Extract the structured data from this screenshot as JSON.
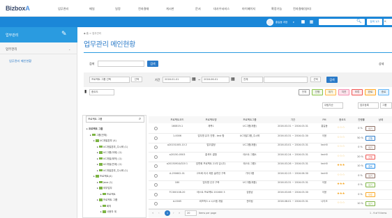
{
  "brand": {
    "name": "BizboxA",
    "suffix": "A"
  },
  "top_menu": [
    "업무관리",
    "메일",
    "일정",
    "전자결재",
    "게시판",
    "문서",
    "대사우서비스",
    "마이페이지",
    "확장기능",
    "전자결재(영리)"
  ],
  "header": {
    "user_name": "홍길동 과장",
    "search_btn": "검색 1/3"
  },
  "sidebar": {
    "title": "업무관리",
    "section": "업무관리",
    "item": "업무관리 메인현황"
  },
  "breadcrumb": "◆ 홈 > 업무관리",
  "page_title": "업무관리 메인현황",
  "filter1": {
    "label": "검색",
    "search_btn": "검색",
    "right_label": "상세"
  },
  "filter2": {
    "select1": "프로젝트 그룹 선택",
    "btn_select": "선택",
    "period_label": "기간",
    "date_from": "2016-01-01",
    "date_to": "2016-06-01",
    "select_all": "전체",
    "btn_select2": "선택",
    "btn_search": "검색"
  },
  "fbar": {
    "select": "중요도"
  },
  "filter_tags": [
    {
      "label": "전체",
      "color": "#999",
      "bg": "#fff"
    },
    {
      "label": "진행",
      "color": "#8bc34a",
      "bg": "#f1f8e9"
    },
    {
      "label": "대기",
      "color": "#ffb74d",
      "bg": "#fff8e1"
    },
    {
      "label": "지연",
      "color": "#f48fb1",
      "bg": "#fce4ec"
    },
    {
      "label": "보류",
      "color": "#ef5350",
      "bg": "#ffebee"
    },
    {
      "label": "완료",
      "color": "#ffa726",
      "bg": "#fff3e0"
    },
    {
      "label": "종료",
      "color": "#64b5f6",
      "bg": "#e3f2fd"
    }
  ],
  "right_selects": {
    "s1": "내림차순",
    "s2": "업무등록",
    "s3": "그룹"
  },
  "tree": {
    "search_placeholder": "프로젝트 그룹",
    "nodes": [
      {
        "label": "프로젝트 그룹",
        "indent": 0,
        "folder": false,
        "bold": true
      },
      {
        "label": "그룹(전체)",
        "indent": 1,
        "folder": true
      },
      {
        "label": "UC개발본부 (4)",
        "indent": 2,
        "folder": true
      },
      {
        "label": "UC개발본부_주시혁 (1)",
        "indent": 3,
        "folder": true
      },
      {
        "label": "UC그룹(국제) (1)",
        "indent": 3,
        "folder": true
      },
      {
        "label": "UC개발(제작) (1)",
        "indent": 3,
        "folder": true
      },
      {
        "label": "UC개발(연계) (1)",
        "indent": 3,
        "folder": true
      },
      {
        "label": "UC개발본부_주시혁 (1)",
        "indent": 3,
        "folder": true
      },
      {
        "label": "프로젝트(4)",
        "indent": 2,
        "folder": true
      },
      {
        "label": "Java (1)",
        "indent": 3,
        "folder": true
      },
      {
        "label": "외부업무",
        "indent": 3,
        "folder": true
      },
      {
        "label": "프로젝트",
        "indent": 4,
        "folder": true
      },
      {
        "label": "프로젝트 그룹",
        "indent": 3,
        "folder": true
      },
      {
        "label": "회의",
        "indent": 4,
        "folder": true
      },
      {
        "label": "사용자 계",
        "indent": 4,
        "folder": true
      }
    ]
  },
  "grid": {
    "columns": [
      "",
      "프로젝트코드",
      "프로젝트명",
      "프로젝트그룹",
      "기간",
      "PM",
      "중요도",
      "진행률",
      "상태"
    ],
    "rows": [
      {
        "code": "160819-1",
        "name": "제목1",
        "group": "UC그룹(제품)",
        "period": "2016.03.31 ~ 2016.03.31",
        "pm": "홍길동",
        "stars": 0,
        "pct": "0 %",
        "status": "대기",
        "status_color": "#8d6e63"
      },
      {
        "code": "1-0006",
        "name": "업무명 유지 진행 - test 함",
        "group": "UC개발그룹_주시혁",
        "period": "2016.03.31 ~ 2016.02.30",
        "pm": "이윤",
        "stars": 0,
        "pct": "50 %",
        "status": "진행",
        "status_color": "#2a7ac8"
      },
      {
        "code": "a20151005-10 2",
        "name": "업무결정",
        "group": "UC그룹(제품)",
        "period": "2016.03.01 ~ 2016.03.31",
        "pm": "tech5",
        "stars": 0,
        "pct": "0 %",
        "status": "대기",
        "status_color": "#8d6e63"
      },
      {
        "code": "a20150-0503",
        "name": "홍색도 결함",
        "group": "테스트 그룹A",
        "period": "2016.02.24 ~ 2016.03.31",
        "pm": "tech5",
        "stars": 0,
        "pct": "20 %",
        "status": "진행",
        "status_color": "#ef5350"
      },
      {
        "code": "a20150910/020 1",
        "name": "담면회 프로젝트 21의 입니다.",
        "group": "테스트 그룹1",
        "period": "2016.03.26 ~ 2016.03.31",
        "pm": "tech5",
        "stars": 3,
        "pct": "10 %",
        "status": "종료",
        "status_color": "#1e88e5"
      },
      {
        "code": "A-250602-01",
        "name": "고도화 리사 제한 솔루션 구축",
        "group": "기타그룹",
        "period": "2016.02.23 ~ 2016.06.30",
        "pm": "tech5",
        "stars": 0,
        "pct": "0 %",
        "status": "대기",
        "status_color": "#8d6e63"
      },
      {
        "code": "180",
        "name": "업무명 신규 구축",
        "group": "UC그룹(제품)",
        "period": "2016.03.31 ~ 2016.03.31",
        "pm": "이윤",
        "stars": 3,
        "pct": "0 %",
        "status": "대기",
        "status_color": "#7cb342"
      },
      {
        "code": "TC300108-20",
        "name": "테스트 프로젝트 201600 3",
        "group": "검정남",
        "period": "2016.03.06 ~ 2016.03.30",
        "pm": "이윤",
        "stars": 3,
        "pct": "0 %",
        "status": "보류",
        "status_color": "#f9a825"
      },
      {
        "code": "A-0045",
        "name": "비즈박스 e 시스템 개발",
        "group": "관리팀",
        "period": "2016.08.01 ~ 2016.03.31",
        "pm": "나이크",
        "stars": 0,
        "pct": "10 %",
        "status": "대기",
        "status_color": "#7cb342"
      }
    ]
  },
  "pager": {
    "page": "1",
    "per_page": "20",
    "per_page_label": "Items per page",
    "summary": "1 - 9 of 9 items"
  }
}
